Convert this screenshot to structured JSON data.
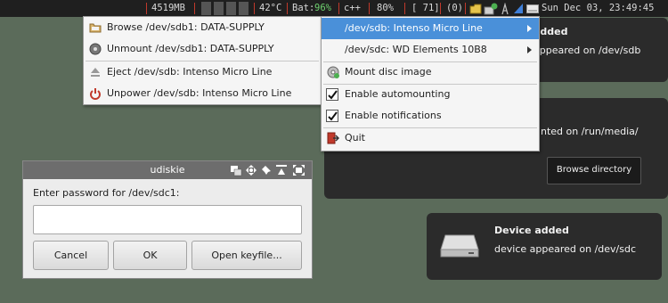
{
  "statusbar": {
    "memory": "4519MB",
    "temp": "42°C",
    "battery_label": "Bat:",
    "battery_value": "96%",
    "cpp": "c++",
    "volume": "80%",
    "count": "[ 71]",
    "unread": "(0)",
    "clock": "Sun Dec 03, 23:49:45"
  },
  "notifications": [
    {
      "title": "added",
      "body": "appeared on /dev/sdb"
    },
    {
      "body": "nted on /run/media/",
      "button": "Browse directory"
    },
    {
      "title": "Device added",
      "body": "device appeared on /dev/sdc"
    }
  ],
  "menu_left": {
    "items": [
      {
        "label": "Browse /dev/sdb1: DATA-SUPPLY",
        "icon": "folder-icon"
      },
      {
        "label": "Unmount /dev/sdb1: DATA-SUPPLY",
        "icon": "unmount-icon"
      },
      {
        "label": "Eject /dev/sdb: Intenso Micro Line",
        "icon": "eject-icon"
      },
      {
        "label": "Unpower /dev/sdb: Intenso Micro Line",
        "icon": "power-icon"
      }
    ]
  },
  "menu_right": {
    "devices": [
      {
        "label": "/dev/sdb: Intenso Micro Line"
      },
      {
        "label": "/dev/sdc: WD Elements 10B8"
      }
    ],
    "mount_image": "Mount disc image",
    "auto_mount": "Enable automounting",
    "notifications": "Enable notifications",
    "quit": "Quit"
  },
  "dialog": {
    "title": "udiskie",
    "prompt": "Enter password for /dev/sdc1:",
    "password_value": "",
    "cancel": "Cancel",
    "ok": "OK",
    "keyfile": "Open keyfile..."
  },
  "colors": {
    "desktop": "#5b6b5a",
    "bar": "#1f1f1f",
    "highlight": "#4a90d9",
    "notification": "#2b2b2b",
    "battery": "#6fd26f"
  }
}
